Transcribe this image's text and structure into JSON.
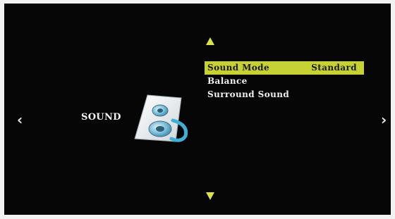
{
  "section": {
    "title": "SOUND",
    "icon": "speaker-icon"
  },
  "nav": {
    "prev_glyph": "‹",
    "next_glyph": "›",
    "up_icon": "triangle-up-icon",
    "down_icon": "triangle-down-icon"
  },
  "menu": {
    "items": [
      {
        "label": "Sound Mode",
        "value": "Standard",
        "selected": true
      },
      {
        "label": "Balance",
        "value": "",
        "selected": false
      },
      {
        "label": "Surround Sound",
        "value": "",
        "selected": false
      }
    ]
  },
  "colors": {
    "highlight": "#c6d234",
    "arrow": "#d8e24a",
    "background": "#060606",
    "text": "#f0f0f0"
  }
}
